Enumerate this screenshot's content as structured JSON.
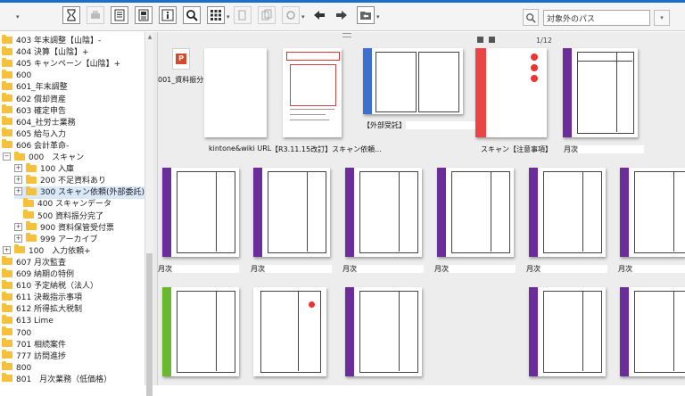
{
  "toolbar": {
    "buttons": [
      {
        "icon": "hourglass-icon"
      },
      {
        "icon": "print-icon"
      },
      {
        "icon": "document-list-icon"
      },
      {
        "icon": "document-view-icon"
      },
      {
        "icon": "info-icon"
      },
      {
        "icon": "search-icon"
      },
      {
        "icon": "grid-view-icon"
      },
      {
        "icon": "copy-icon"
      },
      {
        "icon": "paste-icon"
      },
      {
        "icon": "sync-icon"
      },
      {
        "icon": "back-arrow-icon"
      },
      {
        "icon": "forward-arrow-icon"
      },
      {
        "icon": "folder-open-icon"
      }
    ],
    "search_scope": "対象外のパス"
  },
  "tree": [
    {
      "label": "403 年末調整【山陰】-",
      "level": 0
    },
    {
      "label": "404 決算【山陰】+",
      "level": 0
    },
    {
      "label": "405 キャンペーン【山陰】+",
      "level": 0
    },
    {
      "label": "600",
      "level": 0
    },
    {
      "label": "601_年末調整",
      "level": 0
    },
    {
      "label": "602 償却資産",
      "level": 0
    },
    {
      "label": "603 確定申告",
      "level": 0
    },
    {
      "label": "604_社労士業務",
      "level": 0
    },
    {
      "label": "605 給与入力",
      "level": 0
    },
    {
      "label": "606 会計革命-",
      "level": 0
    },
    {
      "label": "000　スキャン",
      "level": 1,
      "expander": "−"
    },
    {
      "label": "100 入庫",
      "level": 2,
      "expander": "+"
    },
    {
      "label": "200 不足資料あり",
      "level": 2,
      "expander": "+"
    },
    {
      "label": "300 スキャン依頼(外部委託)",
      "level": 2,
      "expander": "+",
      "selected": true
    },
    {
      "label": "400 スキャンデータ",
      "level": 2
    },
    {
      "label": "500 資料振分完了",
      "level": 2
    },
    {
      "label": "900 資料保管受付票",
      "level": 2,
      "expander": "+"
    },
    {
      "label": "999 アーカイブ",
      "level": 2,
      "expander": "+"
    },
    {
      "label": "100　入力依頼+",
      "level": 1,
      "expander": "+"
    },
    {
      "label": "607 月次監査",
      "level": 0
    },
    {
      "label": "609 納期の特例",
      "level": 0
    },
    {
      "label": "610 予定納税（法人）",
      "level": 0
    },
    {
      "label": "611 決裁指示事項",
      "level": 0
    },
    {
      "label": "612 所得拡大税制",
      "level": 0
    },
    {
      "label": "613 Lime",
      "level": 0
    },
    {
      "label": "700",
      "level": 0
    },
    {
      "label": "701 相続案件",
      "level": 0
    },
    {
      "label": "777 訪問進捗",
      "level": 0
    },
    {
      "label": "800",
      "level": 0
    },
    {
      "label": "801　月次業務（低価格）",
      "level": 0
    }
  ],
  "grid": {
    "row1": [
      {
        "label": "001_資料振分",
        "type": "pdf-icon"
      },
      {
        "label": "kintone&wiki URL",
        "type": "blank"
      },
      {
        "label": "【R3.11.15改訂】スキャン依頼...",
        "type": "red-form"
      },
      {
        "label": "【外部受託】",
        "type": "binder-blue"
      },
      {
        "label": "スキャン【注意事項】",
        "type": "binder-red",
        "page": "1/12"
      },
      {
        "label": "月次",
        "type": "binder-purple"
      }
    ],
    "row2_label": "月次",
    "row3": [
      "green",
      "plain",
      "purple",
      "none",
      "purple",
      "purple"
    ]
  },
  "colors": {
    "binder_purple": "#6a2d9a",
    "binder_blue": "#3b6fd1",
    "binder_red": "#e84545",
    "binder_green": "#6ab82e",
    "folder": "#f5c13d",
    "accent": "#1a6fc8"
  }
}
